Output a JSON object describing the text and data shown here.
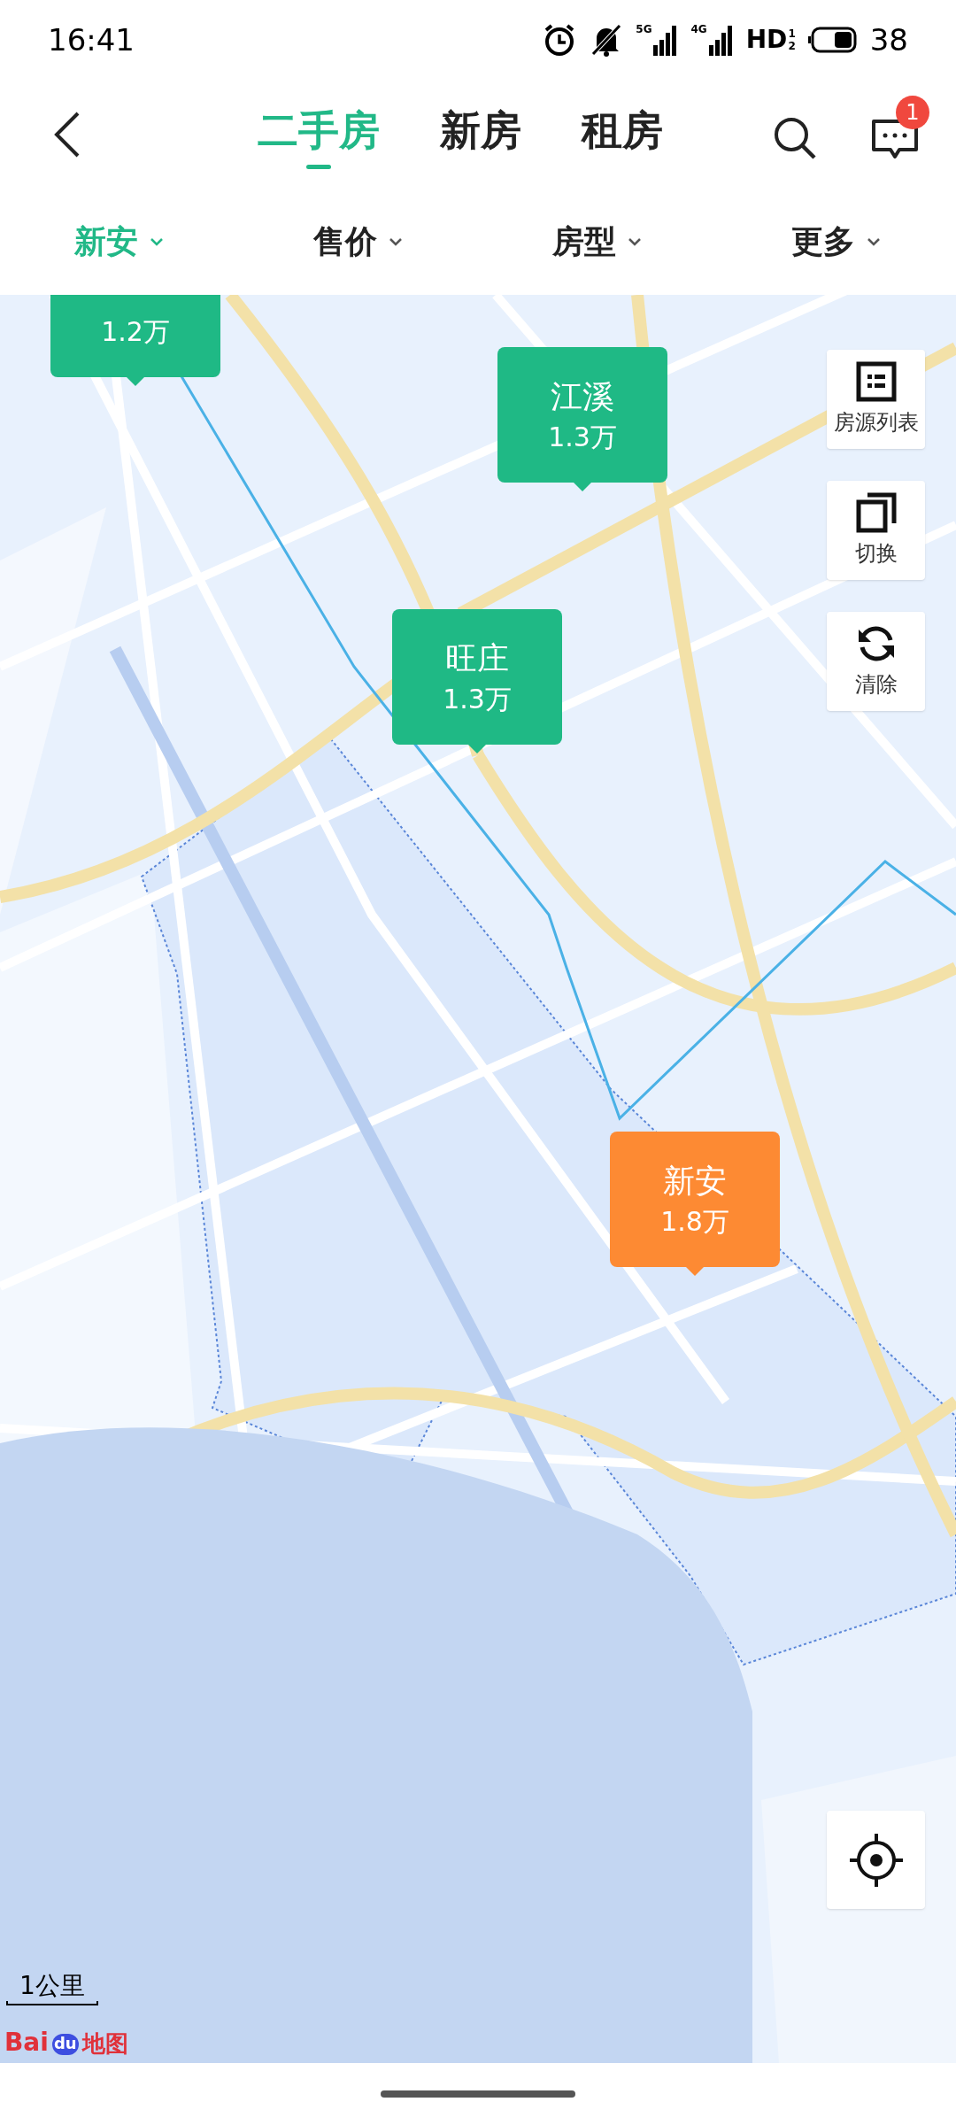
{
  "status_bar": {
    "time": "16:41",
    "network_labels": [
      "5G",
      "4G"
    ],
    "hd_label": "HD",
    "hd_slots": [
      "1",
      "2"
    ],
    "battery_text": "38"
  },
  "header": {
    "tabs": [
      {
        "label": "二手房",
        "selected": true
      },
      {
        "label": "新房",
        "selected": false
      },
      {
        "label": "租房",
        "selected": false
      }
    ],
    "message_badge": "1"
  },
  "filters": [
    {
      "label": "新安",
      "selected": true
    },
    {
      "label": "售价",
      "selected": false
    },
    {
      "label": "房型",
      "selected": false
    },
    {
      "label": "更多",
      "selected": false
    }
  ],
  "map": {
    "markers": [
      {
        "price": "1.2万",
        "selected": false
      },
      {
        "name": "江溪",
        "price": "1.3万",
        "selected": false
      },
      {
        "name": "旺庄",
        "price": "1.3万",
        "selected": false
      },
      {
        "name": "新安",
        "price": "1.8万",
        "selected": true
      }
    ],
    "tools": [
      {
        "kind": "list",
        "label": "房源列表"
      },
      {
        "kind": "switch",
        "label": "切换"
      },
      {
        "kind": "clear",
        "label": "清除"
      }
    ],
    "scale": "1公里",
    "logo": {
      "left": "Bai",
      "paw": "du",
      "right": "地图"
    }
  }
}
